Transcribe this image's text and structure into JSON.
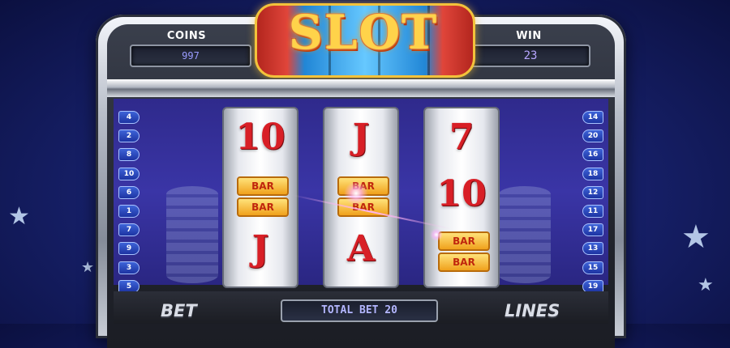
{
  "header": {
    "logo_text": "SLOT",
    "coins_label": "COINS",
    "coins_value": "997",
    "win_label": "WIN",
    "win_value": "23"
  },
  "paylines": {
    "left": [
      "4",
      "2",
      "8",
      "10",
      "6",
      "1",
      "7",
      "9",
      "3",
      "5"
    ],
    "right": [
      "14",
      "20",
      "16",
      "18",
      "12",
      "11",
      "17",
      "13",
      "15",
      "19"
    ]
  },
  "reels": [
    {
      "top": "10",
      "middle": [
        "BAR",
        "BAR"
      ],
      "bottom": "J"
    },
    {
      "top": "J",
      "middle": [
        "BAR",
        "BAR"
      ],
      "bottom": "A"
    },
    {
      "top": "7",
      "middle": [
        "10"
      ],
      "bottom": [
        "BAR",
        "BAR"
      ]
    }
  ],
  "footer": {
    "bet_label": "BET",
    "total_bet": "TOTAL BET 20",
    "lines_label": "LINES"
  },
  "colors": {
    "symbol_red": "#d81f26",
    "bar_gold": "#f0a11c",
    "background_blue": "#18226e"
  }
}
